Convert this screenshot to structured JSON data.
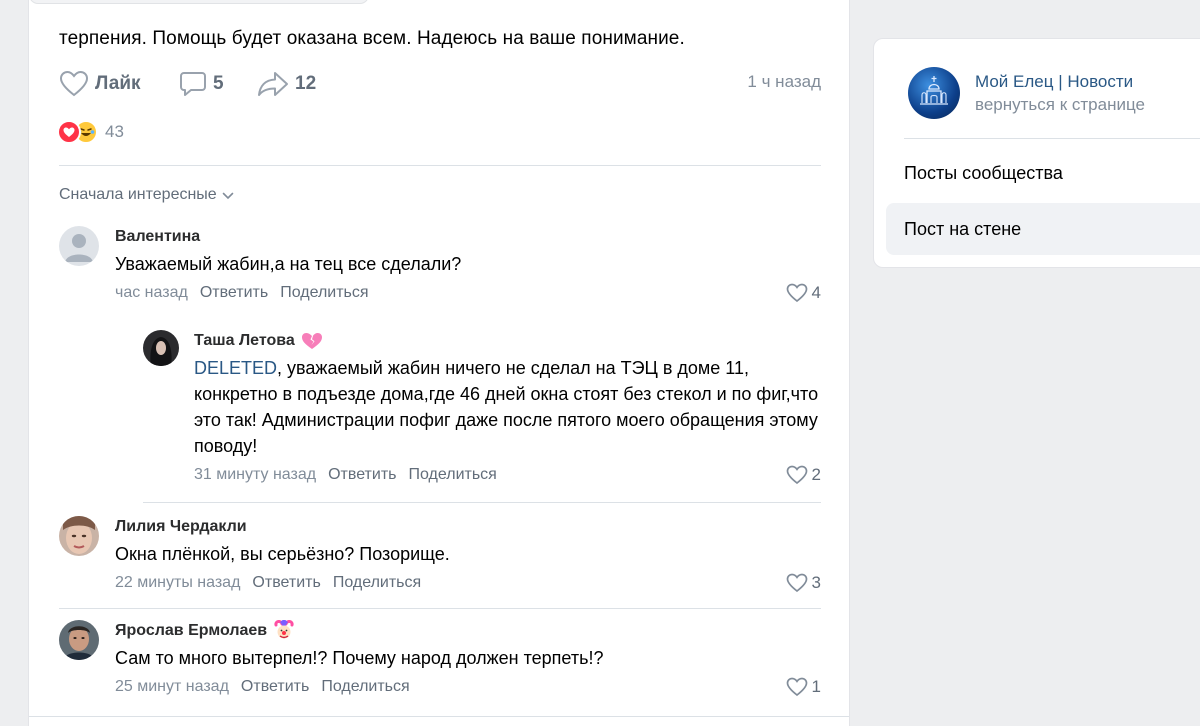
{
  "post": {
    "text_tail": "терпения. Помощь будет оказана всем. Надеюсь на ваше понимание.",
    "like_label": "Лайк",
    "comments_count": "5",
    "shares_count": "12",
    "time": "1 ч назад",
    "reactions_count": "43"
  },
  "sort": {
    "label": "Сначала интересные"
  },
  "comments": [
    {
      "author": "Валентина",
      "text": "Уважаемый жабин,а на тец все сделали?",
      "time": "час назад",
      "reply_label": "Ответить",
      "share_label": "Поделиться",
      "likes": "4"
    },
    {
      "author": "Таша Летова",
      "mention": "DELETED",
      "text": ", уважаемый жабин ничего не сделал на ТЭЦ в доме 11, конкретно в подъезде дома,где 46 дней окна стоят без стекол и по фиг,что это так! Администрации пофиг даже после пятого моего обращения этому поводу!",
      "time": "31 минуту назад",
      "reply_label": "Ответить",
      "share_label": "Поделиться",
      "likes": "2"
    },
    {
      "author": "Лилия Чердакли",
      "text": "Окна плёнкой, вы серьёзно? Позорище.",
      "time": "22 минуты назад",
      "reply_label": "Ответить",
      "share_label": "Поделиться",
      "likes": "3"
    },
    {
      "author": "Ярослав Ермолаев",
      "text": "Сам то много вытерпел!? Почему народ должен терпеть!?",
      "time": "25 минут назад",
      "reply_label": "Ответить",
      "share_label": "Поделиться",
      "likes": "1"
    }
  ],
  "sidebar": {
    "group_name": "Мой Елец | Новости",
    "back_label": "вернуться к странице",
    "menu": [
      "Посты сообщества",
      "Пост на стене"
    ]
  },
  "colors": {
    "link": "#2a5885",
    "secondary": "#818c99",
    "action": "#626d7a",
    "heart_reaction": "#ff3347",
    "laugh_reaction": "#ffc93b"
  }
}
